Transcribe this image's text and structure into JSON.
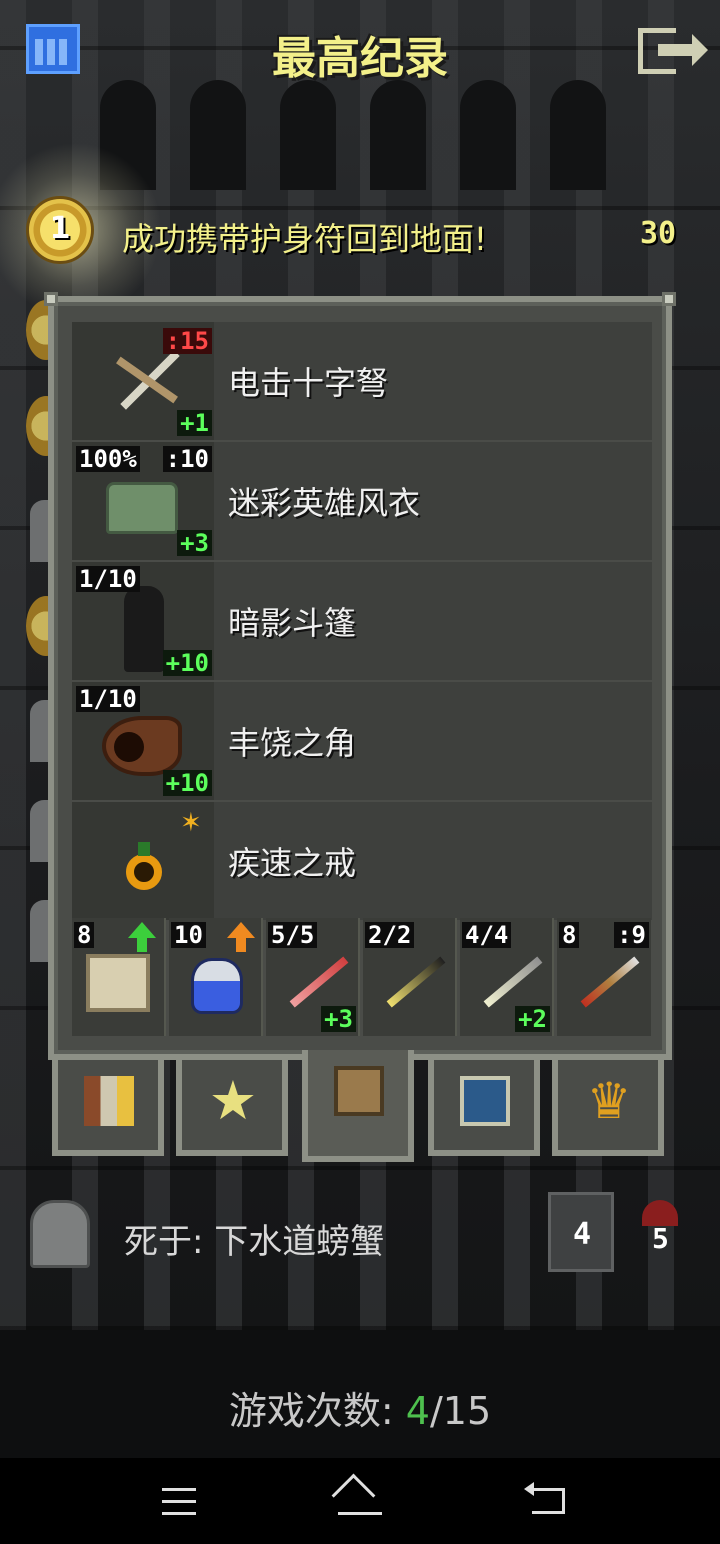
{
  "header": {
    "title": "最高纪录"
  },
  "record": {
    "rank": "1",
    "text": "成功携带护身符回到地面!",
    "score": "30"
  },
  "items": [
    {
      "name": "电击十字弩",
      "icon": "crossbow-icon",
      "tag_top_right": ":15",
      "tag_bottom": "+1"
    },
    {
      "name": "迷彩英雄风衣",
      "icon": "armor-icon",
      "tag_top_left": "100%",
      "tag_top_right": ":10",
      "tag_bottom": "+3"
    },
    {
      "name": "暗影斗篷",
      "icon": "cloak-icon",
      "tag_top_left": "1/10",
      "tag_bottom": "+10"
    },
    {
      "name": "丰饶之角",
      "icon": "horn-icon",
      "tag_top_left": "1/10",
      "tag_bottom": "+10"
    },
    {
      "name": "疾速之戒",
      "icon": "ring-icon"
    }
  ],
  "quickslots": [
    {
      "icon": "scroll-icon",
      "count": "8"
    },
    {
      "icon": "potion-icon",
      "count": "10"
    },
    {
      "icon": "wand-icon",
      "count": "5/5",
      "bonus": "+3"
    },
    {
      "icon": "wand-icon",
      "count": "2/2"
    },
    {
      "icon": "wand-icon",
      "count": "4/4",
      "bonus": "+2"
    },
    {
      "icon": "dart-icon",
      "count": "8",
      "extra": ":9"
    }
  ],
  "tabs": [
    "ranking-icon",
    "star-icon",
    "backpack-icon",
    "shield-icon",
    "trophy-icon"
  ],
  "death": {
    "text": "死于: 下水道螃蟹",
    "depth": "4",
    "level": "5"
  },
  "games": {
    "label": "游戏次数:",
    "current": "4",
    "total": "/15"
  },
  "colors": {
    "title": "#f3f08a",
    "panel": "#4a4c48",
    "bonus_green": "#5cff5c",
    "penalty_red": "#ff4848",
    "games_current": "#4ec04e"
  }
}
